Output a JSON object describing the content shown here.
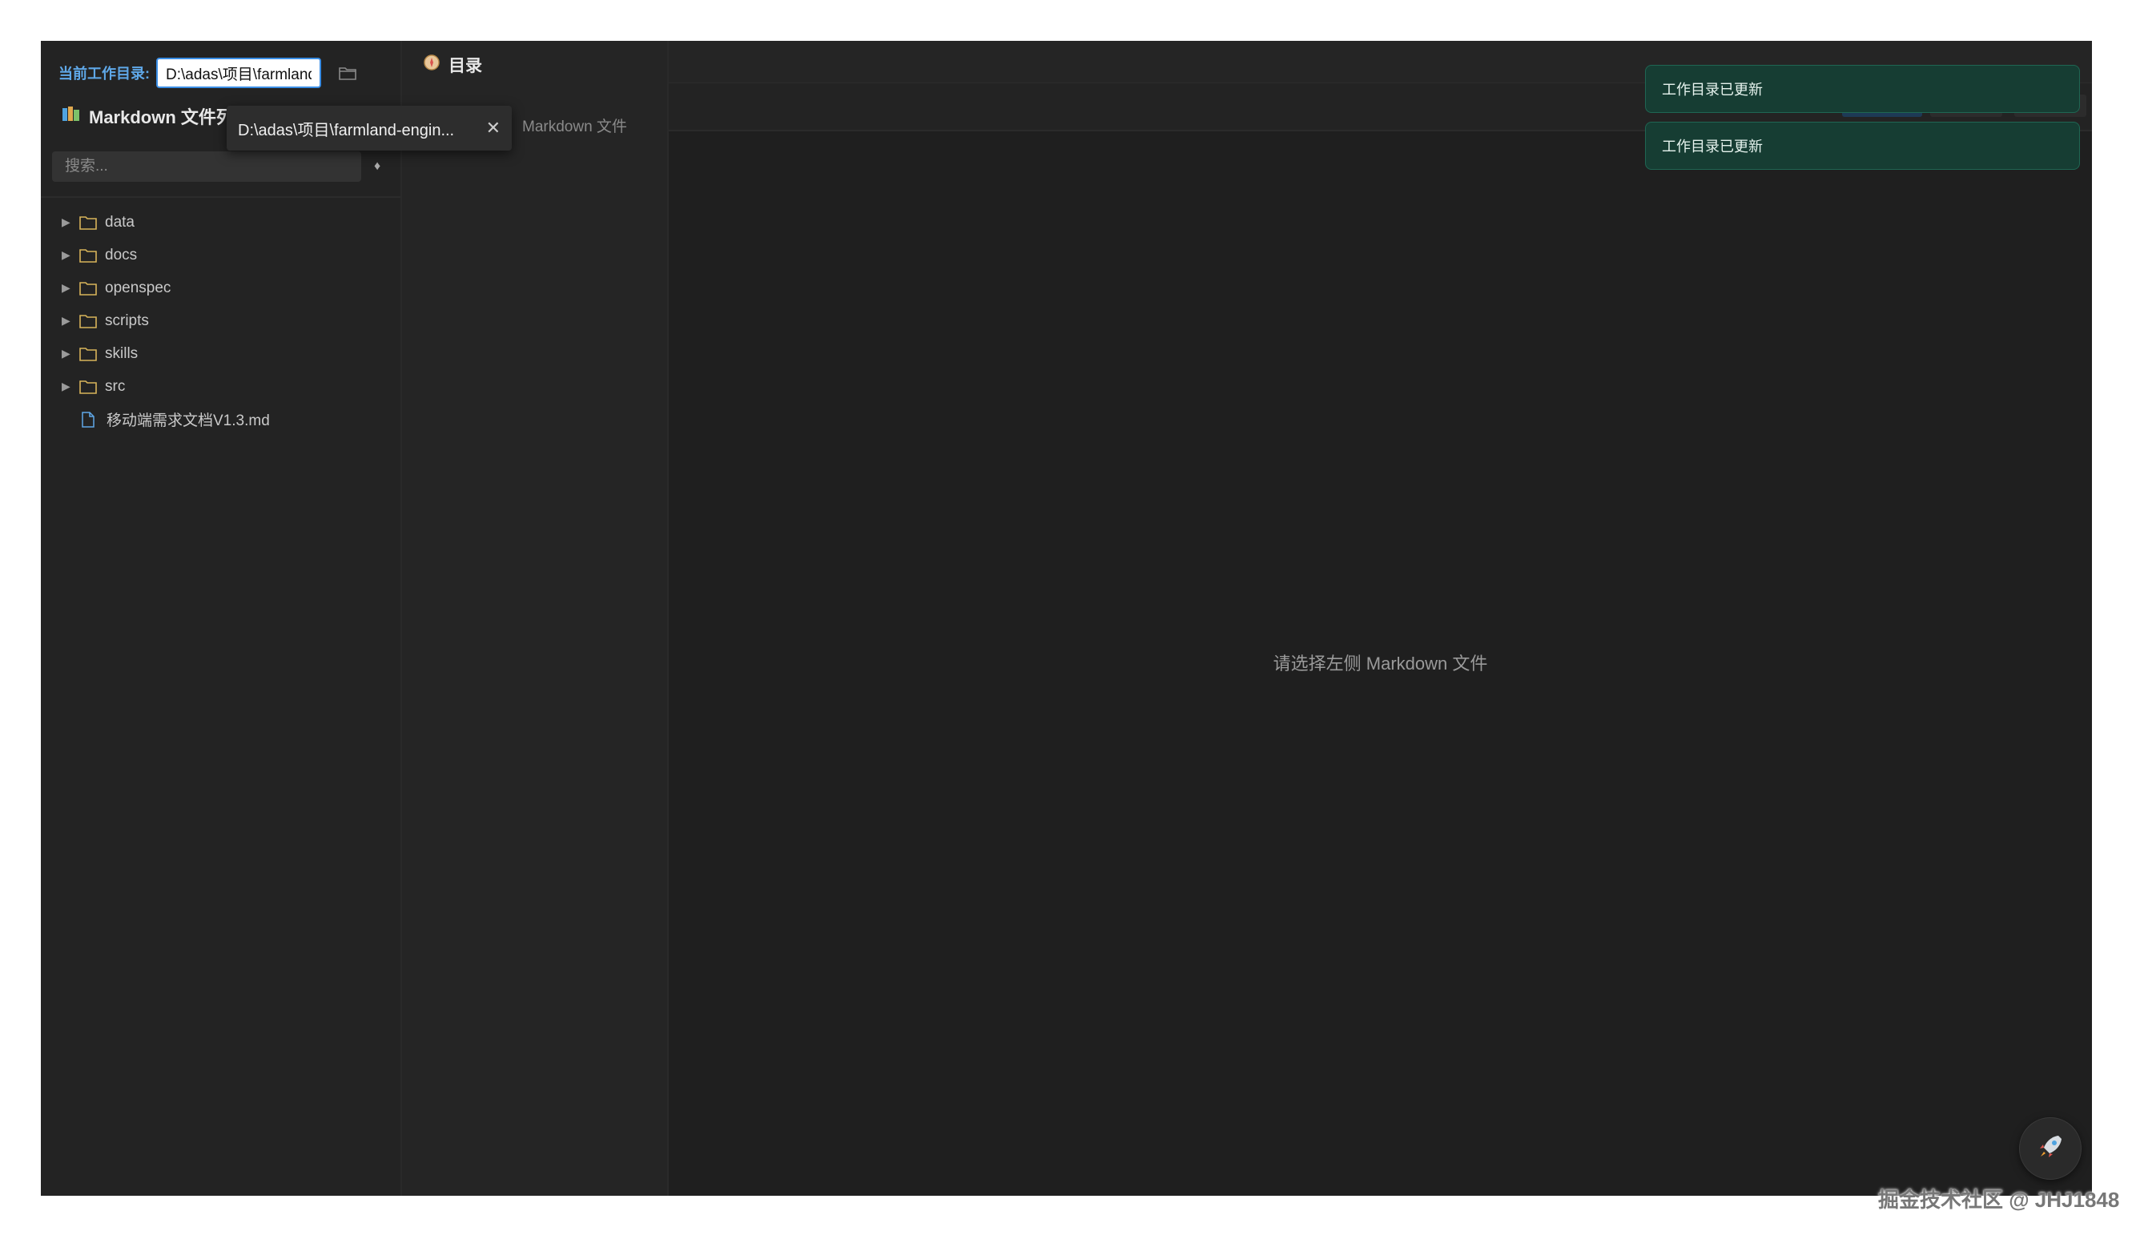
{
  "workdir": {
    "label": "当前工作目录:",
    "value": "D:\\adas\\项目\\farmland-engine"
  },
  "sidebar": {
    "title": "Markdown 文件列表",
    "search_placeholder": "搜索...",
    "refresh_glyph": "♦",
    "tree": [
      {
        "name": "data",
        "type": "folder"
      },
      {
        "name": "docs",
        "type": "folder"
      },
      {
        "name": "openspec",
        "type": "folder"
      },
      {
        "name": "scripts",
        "type": "folder"
      },
      {
        "name": "skills",
        "type": "folder"
      },
      {
        "name": "src",
        "type": "folder"
      },
      {
        "name": "移动端需求文档V1.3.md",
        "type": "file"
      }
    ]
  },
  "tooltip": {
    "text": "D:\\adas\\项目\\farmland-engin...",
    "close_glyph": "✕"
  },
  "toc": {
    "title": "目录",
    "empty_text": "Markdown 文件"
  },
  "main": {
    "empty_text": "请选择左侧 Markdown 文件"
  },
  "toasts": [
    "工作目录已更新",
    "工作目录已更新"
  ],
  "watermark": "掘金技术社区 @ JHJ1848",
  "colors": {
    "accent": "#3a8ee6",
    "toast_bg": "#163d33",
    "folder_icon": "#d8b45a",
    "file_icon": "#5fa8e8"
  }
}
